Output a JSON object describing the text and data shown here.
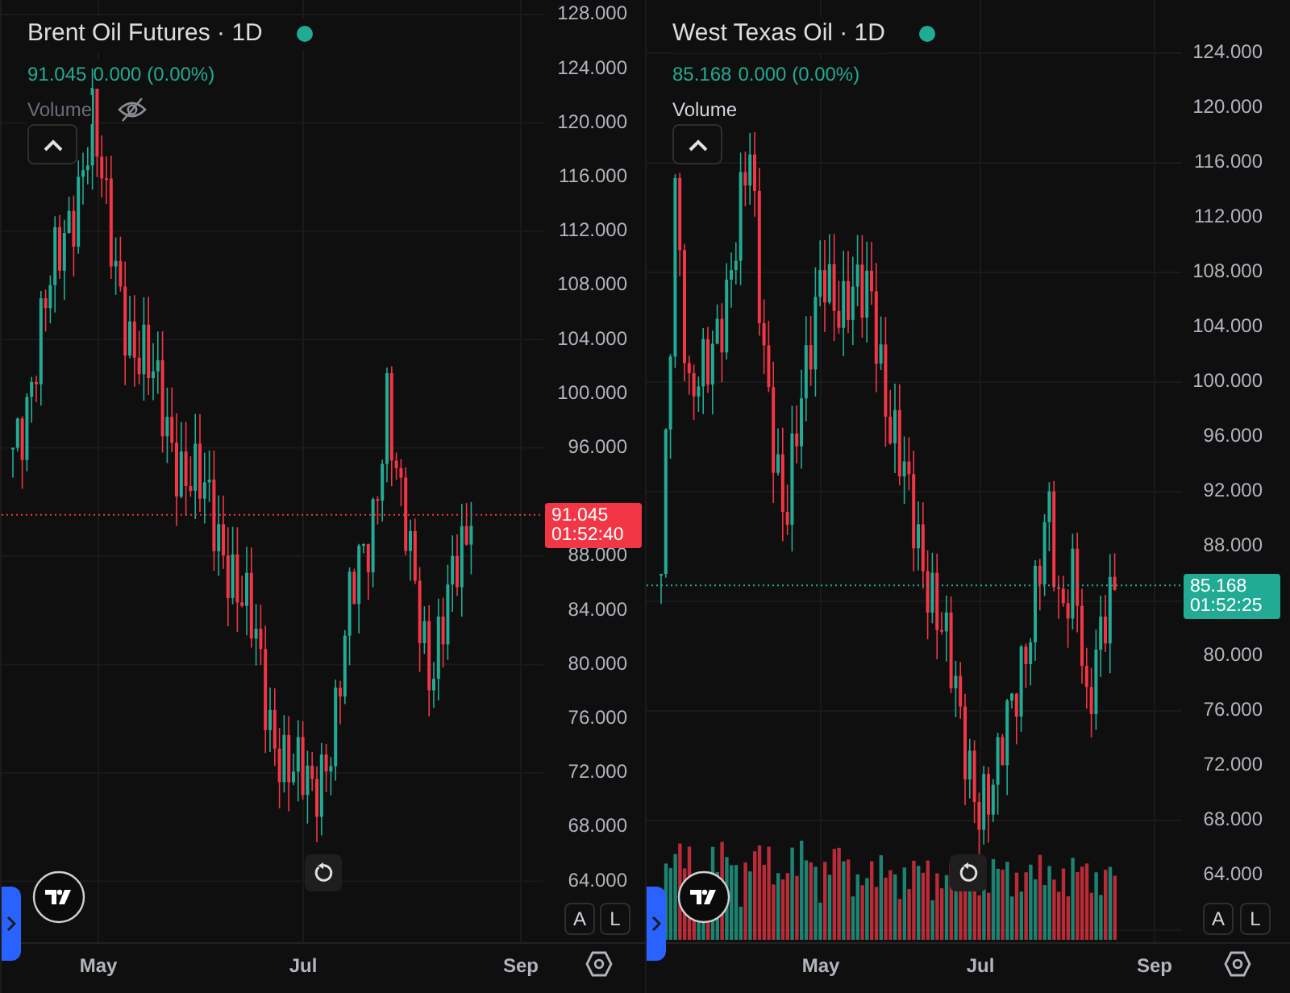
{
  "panels": [
    {
      "symbol": "Brent Oil Futures · 1D",
      "price": "91.045",
      "change": "0.000 (0.00%)",
      "volume_label": "Volume",
      "volume_hidden": true,
      "color": "#f23645",
      "last_price": "91.045",
      "countdown": "01:52:40",
      "yticks": [
        "128.000",
        "124.000",
        "120.000",
        "116.000",
        "112.000",
        "108.000",
        "104.000",
        "100.000",
        "96.000",
        "88.000",
        "84.000",
        "80.000",
        "76.000",
        "72.000",
        "68.000",
        "64.000"
      ],
      "xticks": [
        "May",
        "Jul",
        "Sep"
      ],
      "scale_buttons": [
        "A",
        "L"
      ]
    },
    {
      "symbol": "West Texas Oil · 1D",
      "price": "85.168",
      "change": "0.000 (0.00%)",
      "volume_label": "Volume",
      "volume_hidden": false,
      "color": "#22ab94",
      "last_price": "85.168",
      "countdown": "01:52:25",
      "yticks": [
        "124.000",
        "120.000",
        "116.000",
        "112.000",
        "108.000",
        "104.000",
        "100.000",
        "96.000",
        "92.000",
        "88.000",
        "80.000",
        "76.000",
        "72.000",
        "68.000",
        "64.000"
      ],
      "xticks": [
        "May",
        "Jul",
        "Sep"
      ],
      "scale_buttons": [
        "A",
        "L"
      ]
    }
  ]
}
